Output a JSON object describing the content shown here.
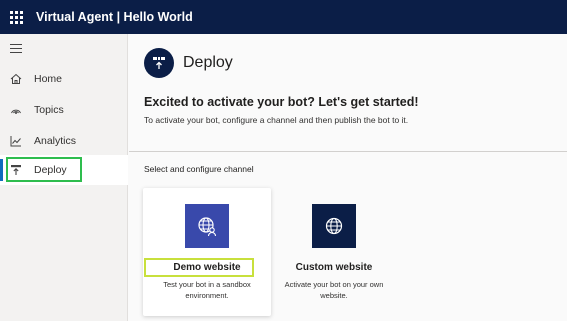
{
  "header": {
    "app_title": "Virtual Agent | Hello World"
  },
  "sidebar": {
    "items": [
      {
        "label": "Home",
        "icon": "home-icon"
      },
      {
        "label": "Topics",
        "icon": "topics-icon"
      },
      {
        "label": "Analytics",
        "icon": "analytics-icon"
      },
      {
        "label": "Deploy",
        "icon": "deploy-icon",
        "active": true
      }
    ]
  },
  "page": {
    "title": "Deploy",
    "headline": "Excited to activate your bot? Let's get started!",
    "subline": "To activate your bot, configure a channel and then publish the bot to it.",
    "section_label": "Select and configure channel"
  },
  "channels": [
    {
      "title": "Demo website",
      "description": "Test your bot in a sandbox environment.",
      "icon": "globe-user-icon",
      "selected": true
    },
    {
      "title": "Custom website",
      "description": "Activate your bot on your own website.",
      "icon": "globe-icon",
      "selected": false
    }
  ],
  "colors": {
    "header_bg": "#0b1e47",
    "demo_icon_bg": "#3949ab",
    "custom_icon_bg": "#0b1e47",
    "active_indicator": "#0f6cbd",
    "nav_highlight": "#2ebd4e",
    "title_highlight": "#c8e03c"
  }
}
